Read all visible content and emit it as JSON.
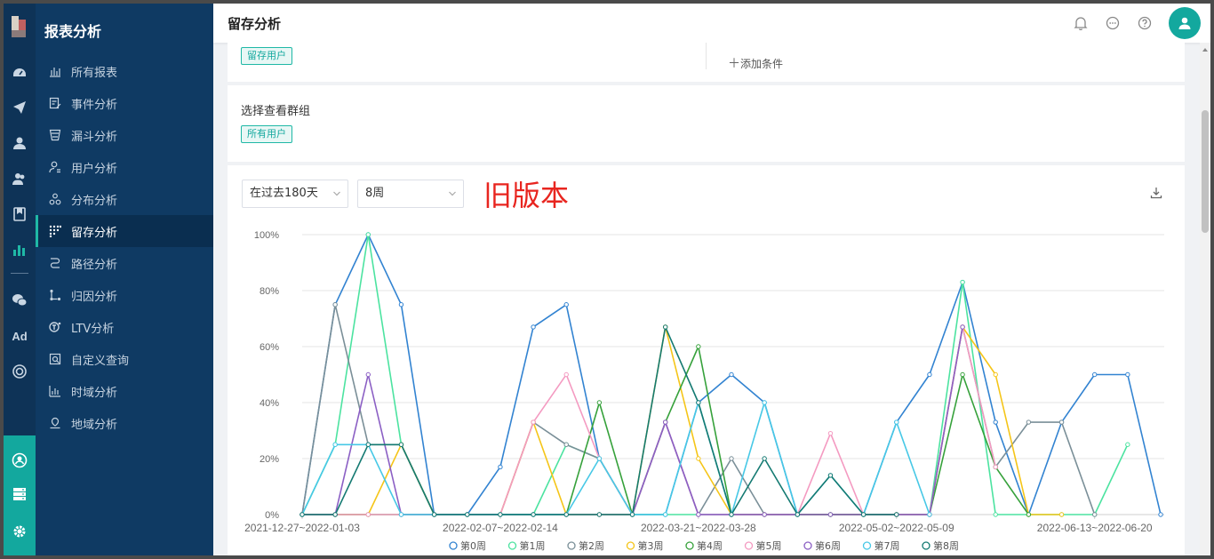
{
  "sidebar": {
    "title": "报表分析",
    "items": [
      {
        "label": "所有报表",
        "icon": "bar-chart-icon"
      },
      {
        "label": "事件分析",
        "icon": "event-icon"
      },
      {
        "label": "漏斗分析",
        "icon": "funnel-icon"
      },
      {
        "label": "用户分析",
        "icon": "user-icon"
      },
      {
        "label": "分布分析",
        "icon": "distribution-icon"
      },
      {
        "label": "留存分析",
        "icon": "retention-icon",
        "active": true
      },
      {
        "label": "路径分析",
        "icon": "path-icon"
      },
      {
        "label": "归因分析",
        "icon": "attribution-icon"
      },
      {
        "label": "LTV分析",
        "icon": "ltv-icon"
      },
      {
        "label": "自定义查询",
        "icon": "query-icon"
      },
      {
        "label": "时域分析",
        "icon": "time-chart-icon"
      },
      {
        "label": "地域分析",
        "icon": "location-icon"
      }
    ]
  },
  "rail": {
    "ad_label": "Ad",
    "icons": [
      "dashboard-icon",
      "send-icon",
      "person-icon",
      "people-icon",
      "bookmark-icon",
      "stats-icon",
      "wechat-icon",
      "ad-icon",
      "target-icon",
      "user-circle-icon",
      "server-icon",
      "gear-icon"
    ]
  },
  "header": {
    "title": "留存分析"
  },
  "filters": {
    "retained_tag": "留存用户",
    "add_condition": "添加条件",
    "group_label": "选择查看群组",
    "group_tag": "所有用户"
  },
  "controls": {
    "range": "在过去180天",
    "period": "8周",
    "annotation": "旧版本"
  },
  "colors": {
    "accent": "#13a89e",
    "sidebar": "#0f3a63",
    "annotation": "#e8251f"
  },
  "chart_data": {
    "type": "line",
    "yticks": [
      "0%",
      "20%",
      "40%",
      "60%",
      "80%",
      "100%"
    ],
    "ylim": [
      0,
      100
    ],
    "x_labels": [
      {
        "i": 0,
        "text": "2021-12-27~2022-01-03"
      },
      {
        "i": 6,
        "text": "2022-02-07~2022-02-14"
      },
      {
        "i": 12,
        "text": "2022-03-21~2022-03-28"
      },
      {
        "i": 18,
        "text": "2022-05-02~2022-05-09"
      },
      {
        "i": 24,
        "text": "2022-06-13~2022-06-20"
      }
    ],
    "points": 27,
    "series": [
      {
        "name": "第0周",
        "color": "#3283d1",
        "values": [
          0,
          75,
          100,
          75,
          0,
          0,
          17,
          67,
          75,
          20,
          0,
          0,
          40,
          50,
          40,
          0,
          0,
          0,
          33,
          50,
          83,
          33,
          0,
          33,
          50,
          50,
          0
        ]
      },
      {
        "name": "第1周",
        "color": "#4ce3a0",
        "values": [
          0,
          25,
          100,
          25,
          0,
          0,
          0,
          0,
          25,
          20,
          0,
          0,
          0,
          0,
          0,
          0,
          0,
          0,
          0,
          0,
          83,
          0,
          0,
          0,
          0,
          25,
          null
        ]
      },
      {
        "name": "第2周",
        "color": "#7a8f98",
        "values": [
          0,
          75,
          25,
          25,
          0,
          0,
          0,
          33,
          25,
          20,
          0,
          33,
          0,
          20,
          0,
          0,
          0,
          0,
          0,
          0,
          67,
          17,
          33,
          33,
          0,
          null,
          null
        ]
      },
      {
        "name": "第3周",
        "color": "#f5c518",
        "values": [
          0,
          0,
          0,
          25,
          0,
          0,
          0,
          33,
          0,
          0,
          0,
          67,
          20,
          0,
          0,
          0,
          0,
          0,
          0,
          0,
          67,
          50,
          0,
          0,
          null,
          null,
          null
        ]
      },
      {
        "name": "第4周",
        "color": "#36a13b",
        "values": [
          0,
          0,
          0,
          0,
          0,
          0,
          0,
          0,
          0,
          40,
          0,
          33,
          60,
          0,
          0,
          0,
          0,
          0,
          0,
          0,
          50,
          17,
          0,
          null,
          null,
          null,
          null
        ]
      },
      {
        "name": "第5周",
        "color": "#f49ac1",
        "values": [
          0,
          0,
          0,
          0,
          0,
          0,
          0,
          33,
          50,
          20,
          0,
          33,
          0,
          0,
          0,
          0,
          29,
          0,
          0,
          0,
          67,
          17,
          null,
          null,
          null,
          null,
          null
        ]
      },
      {
        "name": "第6周",
        "color": "#8b5fc4",
        "values": [
          0,
          0,
          50,
          0,
          0,
          0,
          0,
          0,
          0,
          0,
          0,
          33,
          0,
          0,
          0,
          0,
          0,
          0,
          0,
          0,
          67,
          null,
          null,
          null,
          null,
          null,
          null
        ]
      },
      {
        "name": "第7周",
        "color": "#47c8e6",
        "values": [
          0,
          25,
          25,
          0,
          0,
          0,
          0,
          0,
          0,
          20,
          0,
          0,
          40,
          0,
          40,
          0,
          14,
          0,
          33,
          0,
          null,
          null,
          null,
          null,
          null,
          null,
          null
        ]
      },
      {
        "name": "第8周",
        "color": "#147a72",
        "values": [
          0,
          0,
          25,
          25,
          0,
          0,
          0,
          0,
          0,
          0,
          0,
          67,
          40,
          0,
          20,
          0,
          14,
          0,
          0,
          null,
          null,
          null,
          null,
          null,
          null,
          null,
          null
        ]
      }
    ]
  }
}
